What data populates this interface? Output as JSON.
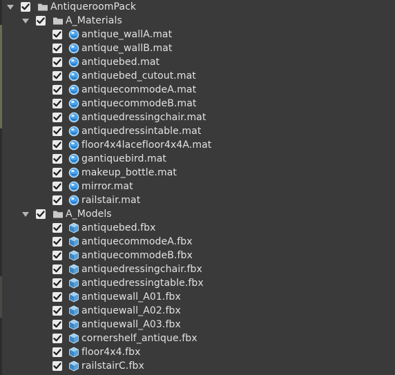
{
  "root": {
    "label": "AntiqueroomPack",
    "checked": true,
    "expanded": true,
    "icon": "folder-icon"
  },
  "materials": {
    "label": "A_Materials",
    "checked": true,
    "expanded": true,
    "icon": "folder-icon",
    "items": [
      "antique_wallA.mat",
      "antique_wallB.mat",
      "antiquebed.mat",
      "antiquebed_cutout.mat",
      "antiquecommodeA.mat",
      "antiquecommodeB.mat",
      "antiquedressingchair.mat",
      "antiquedressintable.mat",
      "floor4x4lacefloor4x4A.mat",
      "gantiquebird.mat",
      "makeup_bottle.mat",
      "mirror.mat",
      "railstair.mat"
    ],
    "item_icon": "material-sphere-icon"
  },
  "models": {
    "label": "A_Models",
    "checked": true,
    "expanded": true,
    "icon": "folder-icon",
    "items": [
      "antiquebed.fbx",
      "antiquecommodeA.fbx",
      "antiquecommodeB.fbx",
      "antiquedressingchair.fbx",
      "antiquedressingtable.fbx",
      "antiquewall_A01.fbx",
      "antiquewall_A02.fbx",
      "antiquewall_A03.fbx",
      "cornershelf_antique.fbx",
      "floor4x4.fbx",
      "railstairC.fbx"
    ],
    "item_icon": "model-cube-icon"
  },
  "colors": {
    "background": "#3a3a3a",
    "text": "#e2e2e2",
    "checkbox": "#eaeaea",
    "sphere": "#4aa3ec",
    "cube": "#5aa0d8"
  }
}
